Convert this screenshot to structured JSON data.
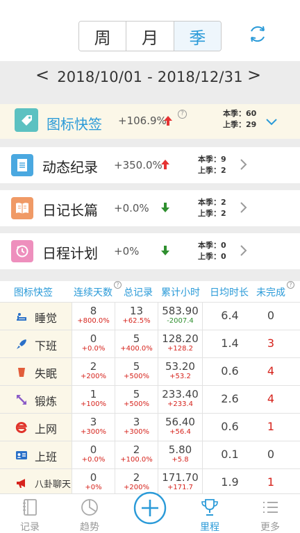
{
  "period_tabs": [
    "周",
    "月",
    "季"
  ],
  "date_range": "2018/10/01 - 2018/12/31",
  "nav_prev": "<",
  "nav_next": ">",
  "categories": [
    {
      "title": "图标快签",
      "pct": "+106.9%",
      "trend": "up",
      "cur": "本季：60",
      "prev": "上季：29",
      "color": "#5cc1c1",
      "icon": "tag-icon"
    },
    {
      "title": "动态纪录",
      "pct": "+350.0%",
      "trend": "up",
      "cur": "本季：9",
      "prev": "上季：2",
      "color": "#4aa8e0",
      "icon": "document-icon"
    },
    {
      "title": "日记长篇",
      "pct": "+0.0%",
      "trend": "down",
      "cur": "本季：2",
      "prev": "上季：2",
      "color": "#f09a66",
      "icon": "book-icon"
    },
    {
      "title": "日程计划",
      "pct": "+0%",
      "trend": "down",
      "cur": "本季：0",
      "prev": "上季：0",
      "color": "#ee8fbd",
      "icon": "clock-icon"
    }
  ],
  "table": {
    "headers": [
      "图标快签",
      "连续天数",
      "总记录",
      "累计小时",
      "日均时长",
      "未完成"
    ],
    "rows": [
      {
        "name": "睡觉",
        "icon": "bed-icon",
        "streak": "8",
        "streak_d": "+800.0%",
        "total": "13",
        "total_d": "+62.5%",
        "hours": "583.90",
        "hours_d": "-2007.4",
        "avg": "6.4",
        "undone": "0"
      },
      {
        "name": "下班",
        "icon": "rocket-icon",
        "streak": "0",
        "streak_d": "+0.0%",
        "total": "5",
        "total_d": "+400.0%",
        "hours": "128.20",
        "hours_d": "+128.2",
        "avg": "1.4",
        "undone": "3"
      },
      {
        "name": "失眠",
        "icon": "cup-icon",
        "streak": "2",
        "streak_d": "+200%",
        "total": "5",
        "total_d": "+500%",
        "hours": "53.20",
        "hours_d": "+53.2",
        "avg": "0.6",
        "undone": "4"
      },
      {
        "name": "锻炼",
        "icon": "expand-arrows-icon",
        "streak": "1",
        "streak_d": "+100%",
        "total": "5",
        "total_d": "+500%",
        "hours": "233.40",
        "hours_d": "+233.4",
        "avg": "2.6",
        "undone": "4"
      },
      {
        "name": "上网",
        "icon": "browser-icon",
        "streak": "3",
        "streak_d": "+300%",
        "total": "3",
        "total_d": "+300%",
        "hours": "56.40",
        "hours_d": "+56.4",
        "avg": "0.6",
        "undone": "1"
      },
      {
        "name": "上班",
        "icon": "id-card-icon",
        "streak": "0",
        "streak_d": "+0.0%",
        "total": "2",
        "total_d": "+100.0%",
        "hours": "5.80",
        "hours_d": "+5.8",
        "avg": "0.1",
        "undone": "0"
      },
      {
        "name": "八卦聊天",
        "icon": "megaphone-icon",
        "streak": "0",
        "streak_d": "+0%",
        "total": "2",
        "total_d": "+200%",
        "hours": "171.70",
        "hours_d": "+171.7",
        "avg": "1.9",
        "undone": "1"
      }
    ]
  },
  "bottom_nav": [
    {
      "label": "记录",
      "icon": "notebook-icon"
    },
    {
      "label": "趋势",
      "icon": "pie-chart-icon"
    },
    {
      "label": "里程",
      "icon": "trophy-icon"
    },
    {
      "label": "更多",
      "icon": "list-icon"
    }
  ],
  "colors": {
    "accent": "#2a9ad8",
    "up": "#e53333",
    "down": "#2f8f2f",
    "highlight_bg": "#fbf7e8"
  }
}
